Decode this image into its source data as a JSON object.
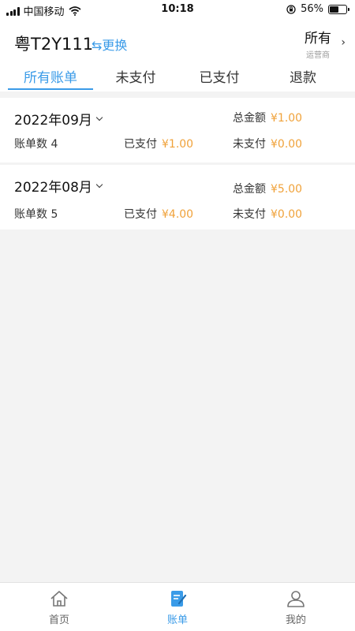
{
  "status_bar": {
    "carrier": "中国移动",
    "time": "10:18",
    "battery": "56%",
    "battery_level": 0.56
  },
  "header": {
    "plate": "粤T2Y111",
    "switch_label": "⇆更换",
    "operator_value": "所有",
    "operator_label": "运营商"
  },
  "tabs": [
    {
      "label": "所有账单",
      "active": true
    },
    {
      "label": "未支付",
      "active": false
    },
    {
      "label": "已支付",
      "active": false
    },
    {
      "label": "退款",
      "active": false
    }
  ],
  "months": [
    {
      "month": "2022年09月",
      "total_label": "总金额",
      "total": "¥1.00",
      "count_label": "账单数",
      "count": "4",
      "paid_label": "已支付",
      "paid": "¥1.00",
      "unpaid_label": "未支付",
      "unpaid": "¥0.00"
    },
    {
      "month": "2022年08月",
      "total_label": "总金额",
      "total": "¥5.00",
      "count_label": "账单数",
      "count": "5",
      "paid_label": "已支付",
      "paid": "¥4.00",
      "unpaid_label": "未支付",
      "unpaid": "¥0.00"
    }
  ],
  "tabbar": [
    {
      "label": "首页",
      "icon": "home-icon",
      "active": false
    },
    {
      "label": "账单",
      "icon": "bill-icon",
      "active": true
    },
    {
      "label": "我的",
      "icon": "user-icon",
      "active": false
    }
  ],
  "colors": {
    "accent": "#3a9be8",
    "amount": "#f0a23a"
  }
}
